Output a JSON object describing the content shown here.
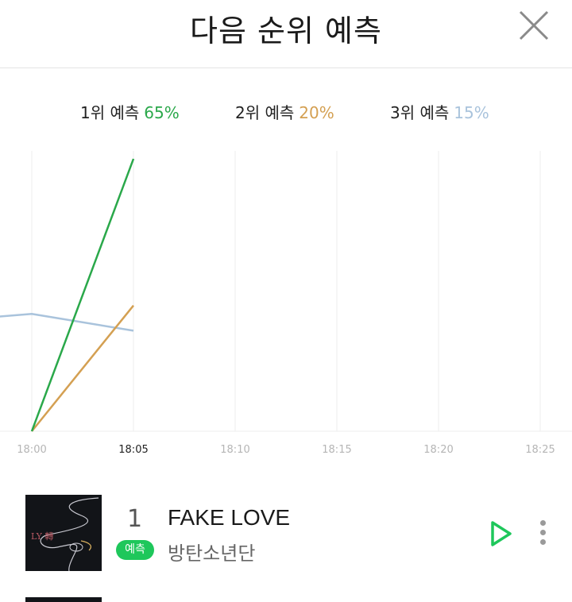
{
  "header": {
    "title": "다음 순위 예측"
  },
  "legend": [
    {
      "label": "1위 예측",
      "pct": "65%",
      "color": "#2aa84a"
    },
    {
      "label": "2위 예측",
      "pct": "20%",
      "color": "#d4a052"
    },
    {
      "label": "3위 예측",
      "pct": "15%",
      "color": "#a9c3dc"
    }
  ],
  "chart_data": {
    "type": "line",
    "x": [
      "18:00",
      "18:05",
      "18:10",
      "18:15",
      "18:20",
      "18:25"
    ],
    "highlighted_x": "18:05",
    "series": [
      {
        "name": "1위 예측",
        "color": "#2aa84a",
        "values": [
          0,
          65
        ]
      },
      {
        "name": "2위 예측",
        "color": "#d4a052",
        "values": [
          0,
          30
        ]
      },
      {
        "name": "3위 예측",
        "color": "#a9c3dc",
        "values": [
          28,
          24
        ]
      }
    ],
    "ylim": [
      0,
      65
    ],
    "grid": true
  },
  "songs": [
    {
      "rank": "1",
      "badge": "예측",
      "title": "FAKE LOVE",
      "artist": "방탄소년단",
      "album_art_text": "LY 轉"
    }
  ]
}
